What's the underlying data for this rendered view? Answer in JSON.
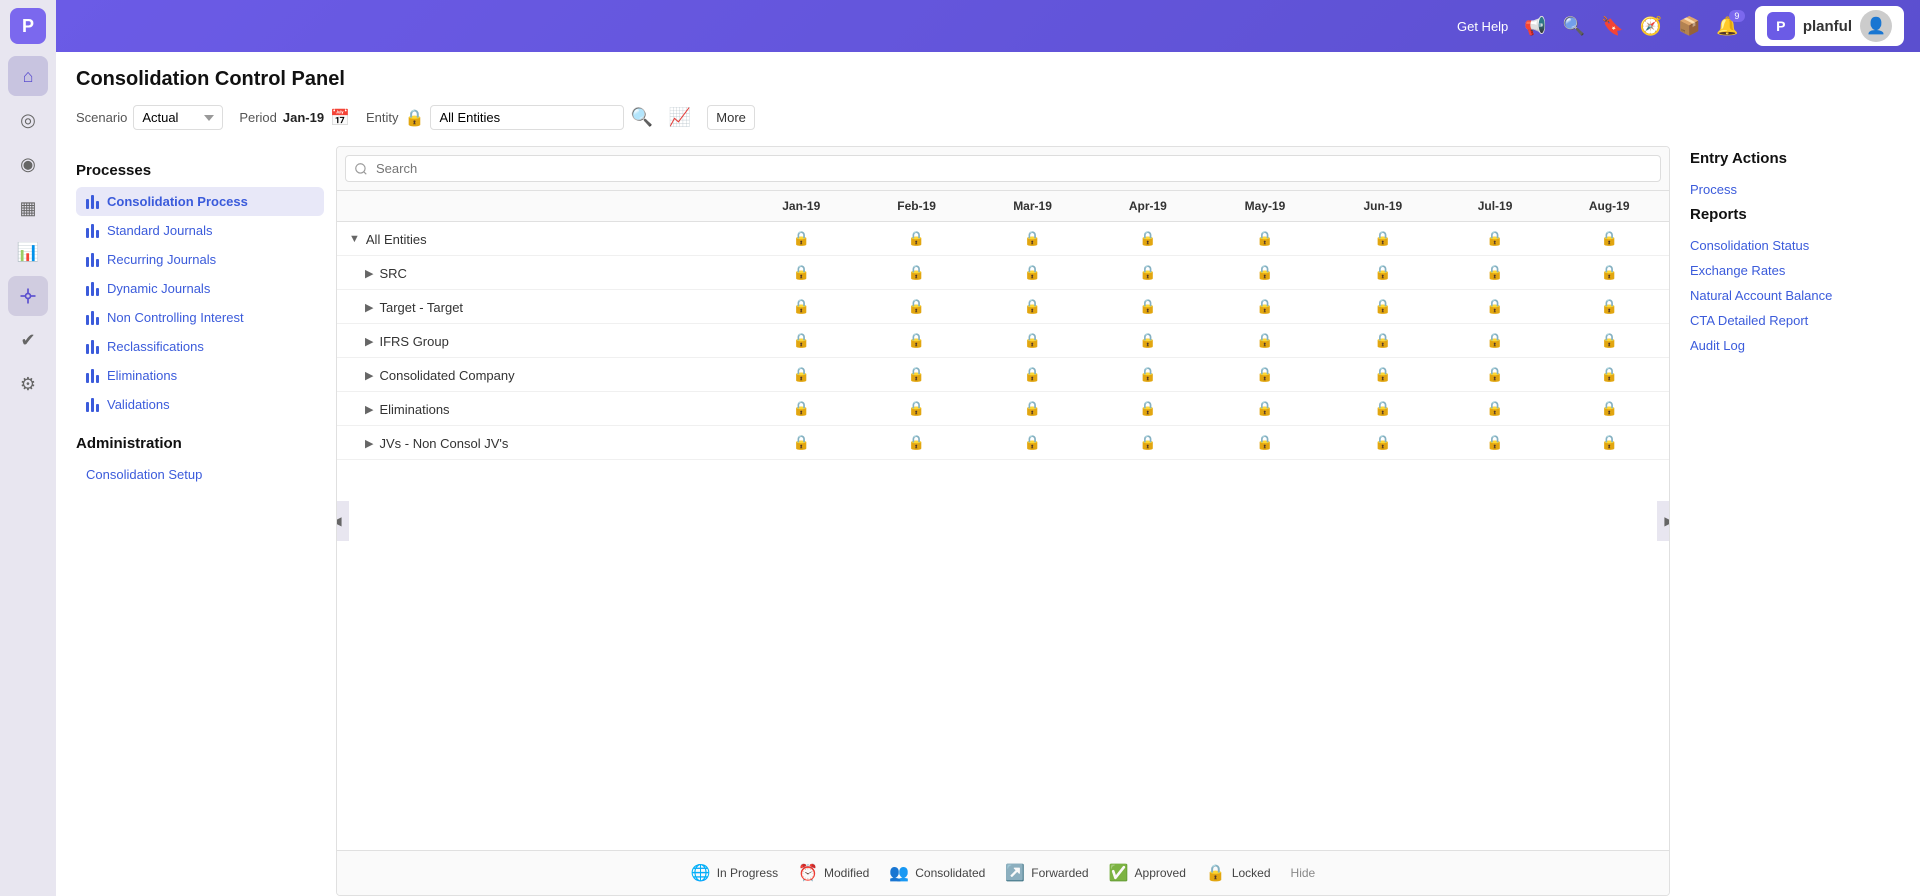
{
  "app": {
    "logo_letter": "P",
    "name": "planful",
    "get_help": "Get Help"
  },
  "header": {
    "badges": {
      "notifications": "9",
      "alerts": ""
    }
  },
  "page": {
    "title": "Consolidation Control Panel"
  },
  "filters": {
    "scenario_label": "Scenario",
    "scenario_value": "Actual",
    "period_label": "Period",
    "period_value": "Jan-19",
    "entity_label": "Entity",
    "entity_value": "All Entities",
    "more_label": "More",
    "search_placeholder": "Search"
  },
  "processes": {
    "section_title": "Processes",
    "items": [
      {
        "id": "consolidation-process",
        "label": "Consolidation Process",
        "active": true
      },
      {
        "id": "standard-journals",
        "label": "Standard Journals",
        "active": false
      },
      {
        "id": "recurring-journals",
        "label": "Recurring Journals",
        "active": false
      },
      {
        "id": "dynamic-journals",
        "label": "Dynamic Journals",
        "active": false
      },
      {
        "id": "non-controlling-interest",
        "label": "Non Controlling Interest",
        "active": false
      },
      {
        "id": "reclassifications",
        "label": "Reclassifications",
        "active": false
      },
      {
        "id": "eliminations",
        "label": "Eliminations",
        "active": false
      },
      {
        "id": "validations",
        "label": "Validations",
        "active": false
      }
    ]
  },
  "administration": {
    "section_title": "Administration",
    "items": [
      {
        "id": "consolidation-setup",
        "label": "Consolidation Setup"
      }
    ]
  },
  "table": {
    "search_placeholder": "Search",
    "columns": [
      "Jan-19",
      "Feb-19",
      "Mar-19",
      "Apr-19",
      "May-19",
      "Jun-19",
      "Jul-19",
      "Aug-19"
    ],
    "rows": [
      {
        "name": "All Entities",
        "level": 0,
        "expanded": true,
        "has_children": true
      },
      {
        "name": "SRC",
        "level": 1,
        "expanded": false,
        "has_children": true
      },
      {
        "name": "Target - Target",
        "level": 1,
        "expanded": false,
        "has_children": true
      },
      {
        "name": "IFRS Group",
        "level": 1,
        "expanded": false,
        "has_children": true
      },
      {
        "name": "Consolidated Company",
        "level": 1,
        "expanded": false,
        "has_children": true
      },
      {
        "name": "Eliminations",
        "level": 1,
        "expanded": false,
        "has_children": true
      },
      {
        "name": "JVs - Non Consol JV's",
        "level": 1,
        "expanded": false,
        "has_children": true
      }
    ]
  },
  "legend": {
    "items": [
      {
        "id": "in-progress",
        "label": "In Progress",
        "symbol": "🌐",
        "color": "#2196f3"
      },
      {
        "id": "modified",
        "label": "Modified",
        "symbol": "⏱",
        "color": "#ff9800"
      },
      {
        "id": "consolidated",
        "label": "Consolidated",
        "symbol": "👤",
        "color": "#9c27b0"
      },
      {
        "id": "forwarded",
        "label": "Forwarded",
        "symbol": "↗",
        "color": "#90a4ae"
      },
      {
        "id": "approved",
        "label": "Approved",
        "symbol": "✅",
        "color": "#4caf50"
      },
      {
        "id": "locked",
        "label": "Locked",
        "symbol": "🔒",
        "color": "#90a4ae"
      }
    ],
    "hide_label": "Hide"
  },
  "entry_actions": {
    "section_title": "Entry Actions",
    "process_link": "Process"
  },
  "reports": {
    "section_title": "Reports",
    "links": [
      "Consolidation Status",
      "Exchange Rates",
      "Natural Account Balance",
      "CTA Detailed Report",
      "Audit Log"
    ]
  },
  "nav": {
    "icons": [
      "⌂",
      "◎",
      "◉",
      "▦",
      "📊",
      "✔",
      "⚙"
    ]
  }
}
